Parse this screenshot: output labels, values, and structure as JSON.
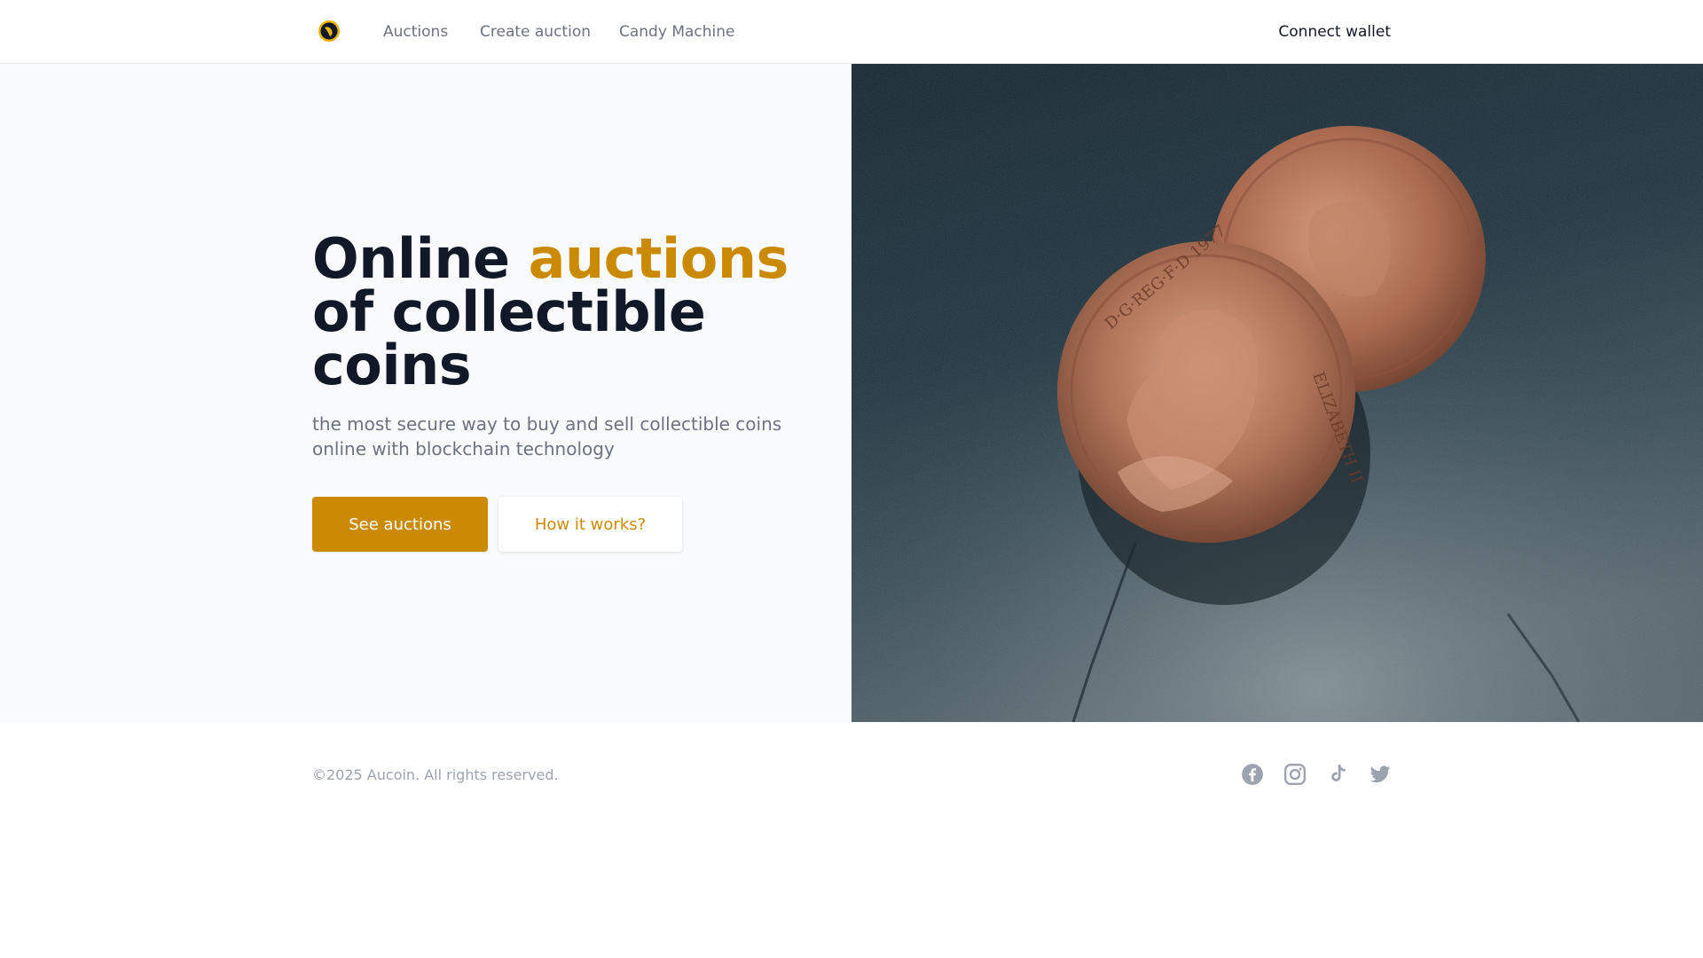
{
  "nav": {
    "logo_name": "aucoin-logo",
    "links": [
      "Auctions",
      "Create auction",
      "Candy Machine"
    ],
    "connect_label": "Connect wallet"
  },
  "hero": {
    "headline_part1": "Online ",
    "headline_accent": "auctions",
    "headline_part2": "of collectible coins",
    "subtitle": "the most secure way to buy and sell collectible coins online with blockchain technology",
    "primary_button": "See auctions",
    "secondary_button": "How it works?",
    "image_description_icon": "coins-photo",
    "coin_front_text_top": "D·G·REG·F·D 1977",
    "coin_front_text_right": "ELIZABETH II"
  },
  "footer": {
    "copyright": "©2025 Aucoin. All rights reserved.",
    "social_icons": [
      "facebook-icon",
      "instagram-icon",
      "tiktok-icon",
      "twitter-icon"
    ]
  },
  "colors": {
    "accent": "#ca8a04",
    "heading": "#111827",
    "muted": "#6b7280",
    "hero_bg": "#f9fafb"
  }
}
